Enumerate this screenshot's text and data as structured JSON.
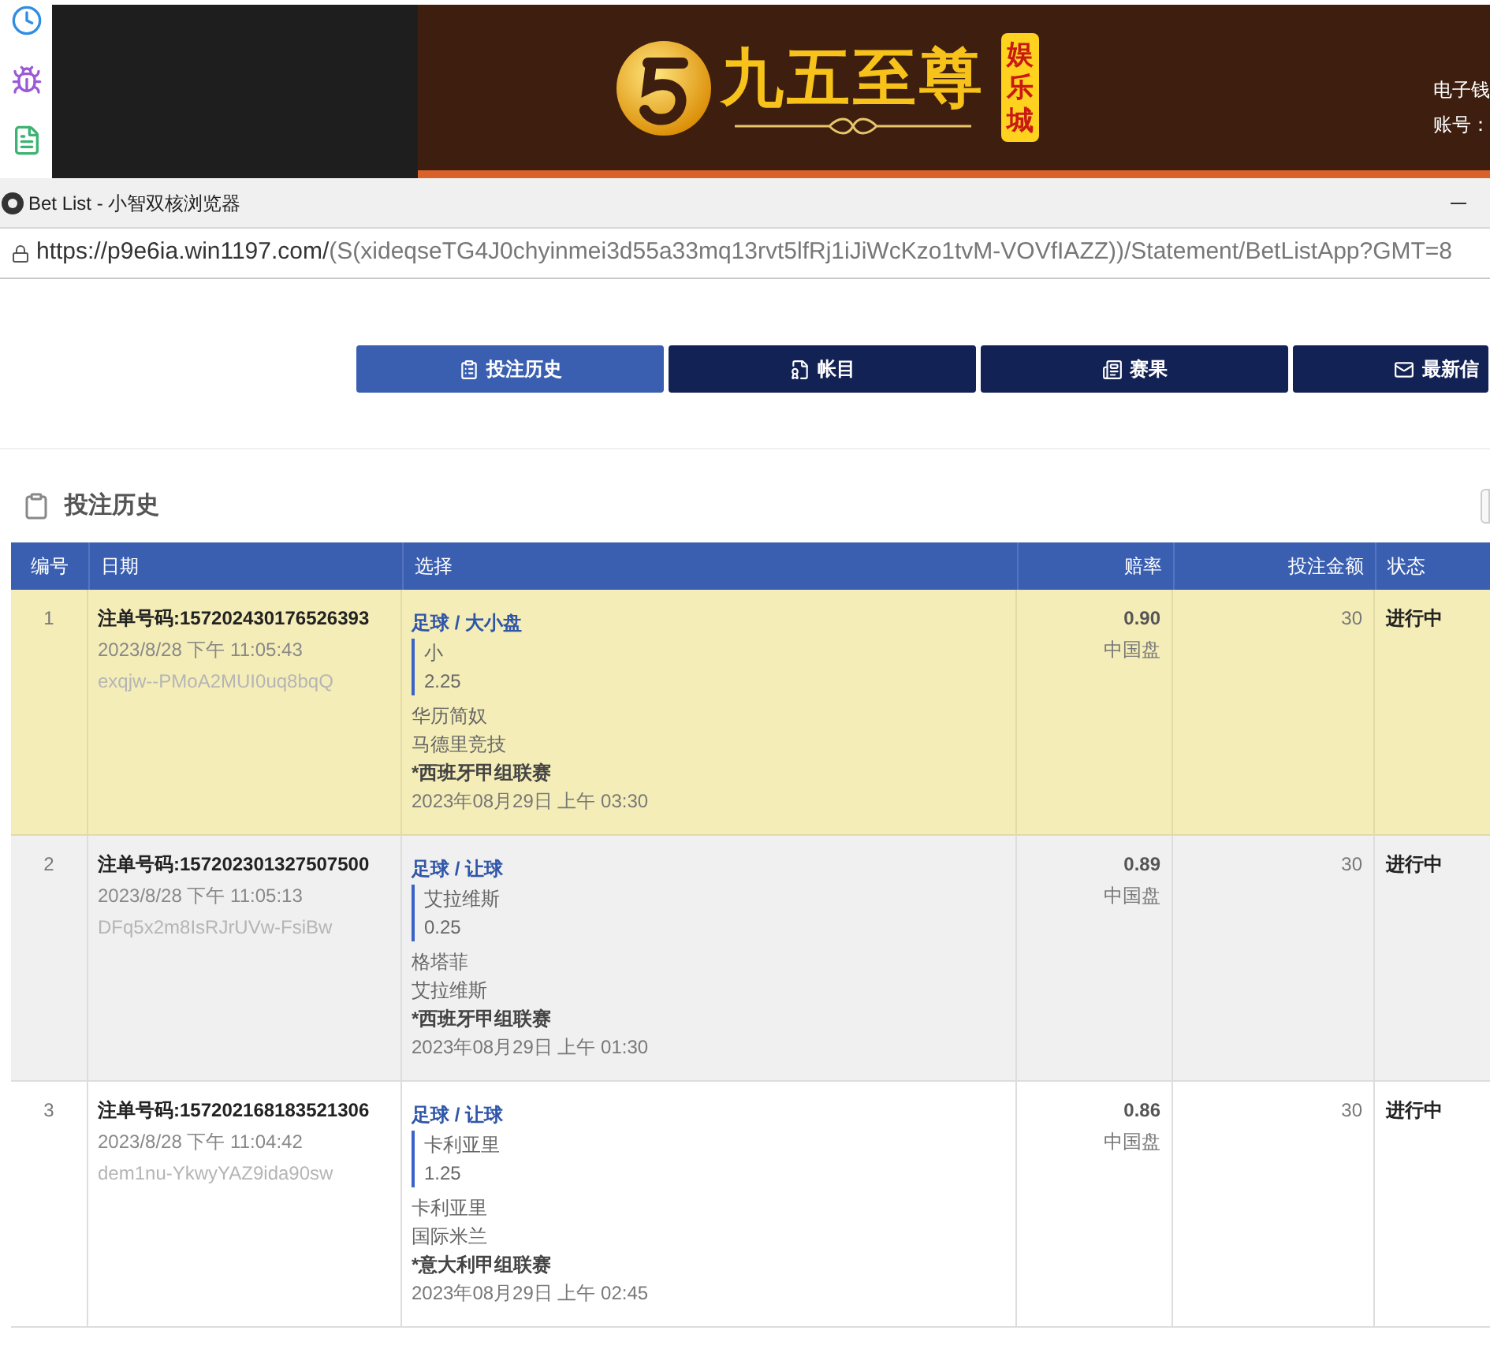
{
  "banner": {
    "brand": "九五至尊",
    "badge": "娱乐城",
    "account_lines": [
      "电子钱",
      "账号："
    ]
  },
  "window": {
    "title": "Bet List - 小智双核浏览器"
  },
  "address_bar": {
    "host": "https://p9e6ia.win1197.com/",
    "path": "(S(xideqseTG4J0chyinmei3d55a33mq13rvt5lfRj1iJiWcKzo1tvM-VOVfIAZZ))/Statement/BetListApp?GMT=8"
  },
  "tabs": [
    {
      "label": "投注历史",
      "selected": true
    },
    {
      "label": "帐目",
      "selected": false
    },
    {
      "label": "赛果",
      "selected": false
    },
    {
      "label": "最新信",
      "selected": false
    }
  ],
  "section_title": "投注历史",
  "table": {
    "columns": [
      "编号",
      "日期",
      "选择",
      "赔率",
      "投注金额",
      "状态"
    ],
    "rows": [
      {
        "number": "1",
        "ticket": "注单号码:157202430176526393",
        "time": "2023/8/28 下午 11:05:43",
        "ref": "exqjw--PMoA2MUI0uq8bqQ",
        "market": "足球 / 大小盘",
        "pick": "小",
        "line": "2.25",
        "home": "华历简奴",
        "away": "马德里竞技",
        "league": "*西班牙甲组联赛",
        "kickoff": "2023年08月29日 上午 03:30",
        "odds": "0.90",
        "odds_type": "中国盘",
        "stake": "30",
        "status": "进行中",
        "selected": true
      },
      {
        "number": "2",
        "ticket": "注单号码:157202301327507500",
        "time": "2023/8/28 下午 11:05:13",
        "ref": "DFq5x2m8IsRJrUVw-FsiBw",
        "market": "足球 / 让球",
        "pick": "艾拉维斯",
        "line": "0.25",
        "home": "格塔菲",
        "away": "艾拉维斯",
        "league": "*西班牙甲组联赛",
        "kickoff": "2023年08月29日 上午 01:30",
        "odds": "0.89",
        "odds_type": "中国盘",
        "stake": "30",
        "status": "进行中",
        "selected": false
      },
      {
        "number": "3",
        "ticket": "注单号码:157202168183521306",
        "time": "2023/8/28 下午 11:04:42",
        "ref": "dem1nu-YkwyYAZ9ida90sw",
        "market": "足球 / 让球",
        "pick": "卡利亚里",
        "line": "1.25",
        "home": "卡利亚里",
        "away": "国际米兰",
        "league": "*意大利甲组联赛",
        "kickoff": "2023年08月29日 上午 02:45",
        "odds": "0.86",
        "odds_type": "中国盘",
        "stake": "30",
        "status": "进行中",
        "selected": false
      }
    ]
  }
}
